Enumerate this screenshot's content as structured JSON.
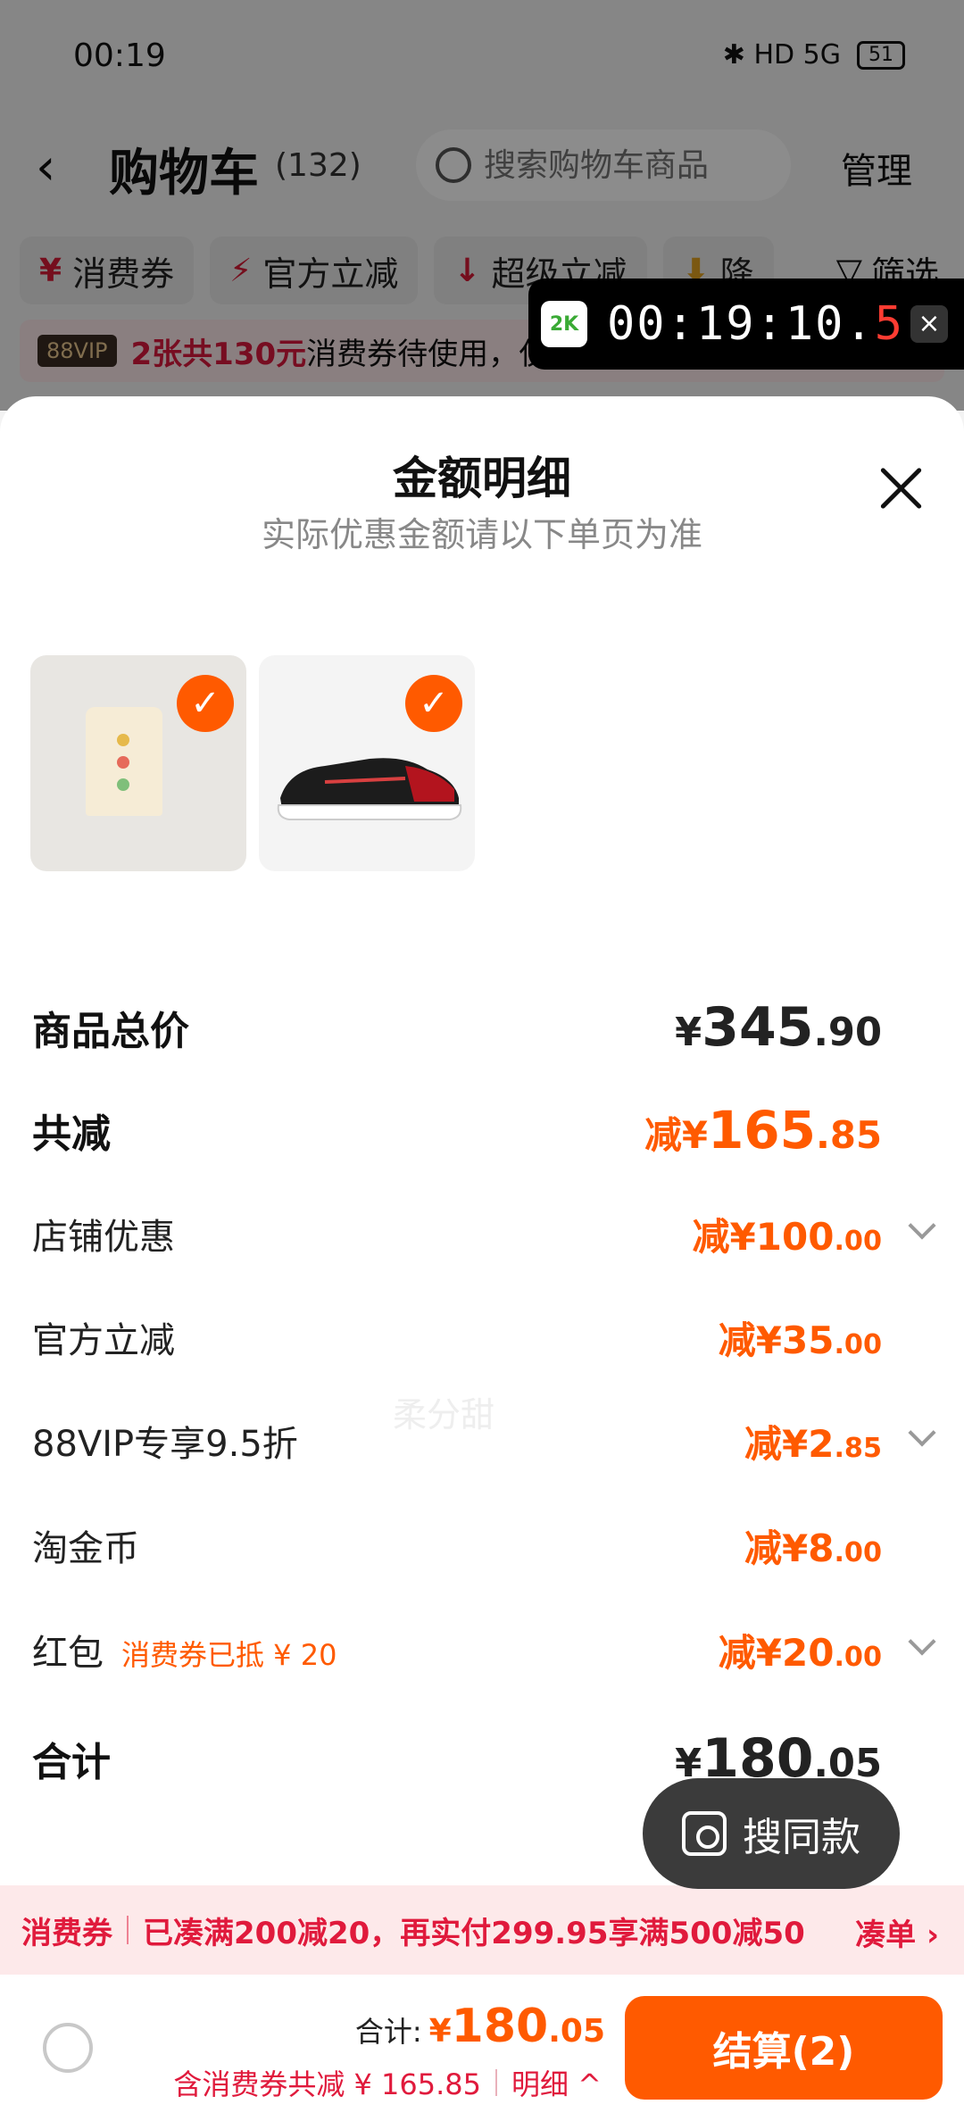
{
  "status_bar": {
    "time": "00:19",
    "icons": "✱ HD 5G",
    "battery": "51"
  },
  "cart_header": {
    "back": "‹",
    "title": "购物车",
    "count": "(132)",
    "search_placeholder": "搜索购物车商品",
    "manage": "管理"
  },
  "chips": [
    {
      "icon": "¥",
      "label": "消费券"
    },
    {
      "icon": "⚡",
      "label": "官方立减"
    },
    {
      "icon": "↓",
      "label": "超级立减"
    },
    {
      "icon": "⬇",
      "label": "降"
    }
  ],
  "filter_label": "筛选",
  "coupon_bar": {
    "badge": "88VIP",
    "highlight": "2张共130元",
    "text": "消费券待使用，仅剩"
  },
  "recorder": {
    "logo": "2K",
    "time_main": "00:19:10.",
    "time_last": "5",
    "close": "×"
  },
  "sheet": {
    "title": "金额明细",
    "subtitle": "实际优惠金额请以下单页为准",
    "thumb_check": "✓",
    "watermark": "柔分甜",
    "rows": {
      "total_price": {
        "label": "商品总价",
        "prefix": "¥",
        "int": "345",
        "dec": ".90"
      },
      "total_discount": {
        "label": "共减",
        "prefix": "减¥",
        "int": "165",
        "dec": ".85"
      },
      "shop_discount": {
        "label": "店铺优惠",
        "prefix": "减¥",
        "int": "100",
        "dec": ".00"
      },
      "official_discount": {
        "label": "官方立减",
        "prefix": "减¥",
        "int": "35",
        "dec": ".00"
      },
      "vip_discount": {
        "label": "88VIP专享9.5折",
        "prefix": "减¥",
        "int": "2",
        "dec": ".85"
      },
      "taojinbi": {
        "label": "淘金币",
        "prefix": "减¥",
        "int": "8",
        "dec": ".00"
      },
      "red_packet": {
        "label": "红包",
        "sub": "消费券已抵 ¥ 20",
        "prefix": "减¥",
        "int": "20",
        "dec": ".00"
      },
      "grand_total": {
        "label": "合计",
        "prefix": "¥",
        "int": "180",
        "dec": ".05"
      }
    }
  },
  "same_style_button": "搜同款",
  "promo_bar": {
    "tag": "消费券",
    "text": "已凑满200减20，再实付299.95享满500减50",
    "link": "凑单 ›"
  },
  "checkout": {
    "total_label": "合计:",
    "total_prefix": "¥",
    "total_int": "180",
    "total_dec": ".05",
    "savings": "含消费券共减 ¥ 165.85",
    "detail": "明细 ^",
    "pay": "结算(2)"
  },
  "colors": {
    "accent": "#ff5a00",
    "promo_red": "#e01a3c",
    "sheet_bg": "#ffffff"
  }
}
